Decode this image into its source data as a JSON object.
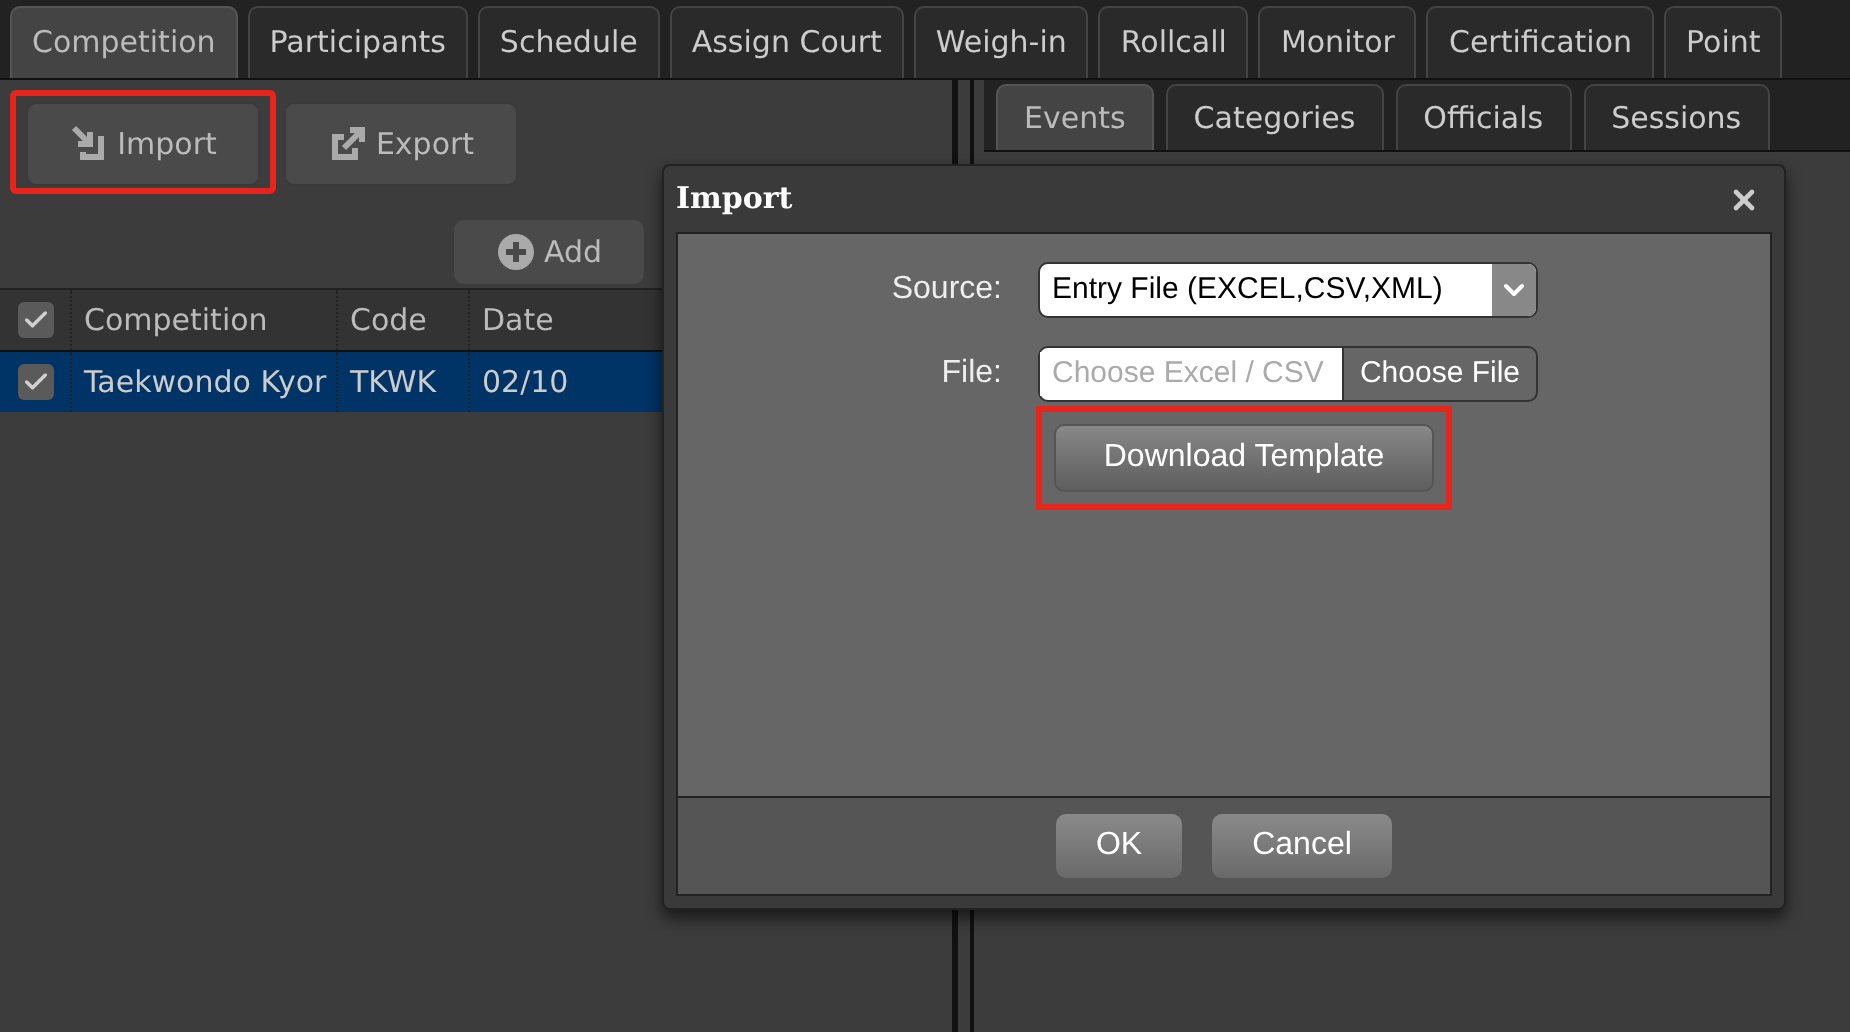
{
  "main_tabs": [
    {
      "label": "Competition",
      "selected": true
    },
    {
      "label": "Participants",
      "selected": false
    },
    {
      "label": "Schedule",
      "selected": false
    },
    {
      "label": "Assign Court",
      "selected": false
    },
    {
      "label": "Weigh-in",
      "selected": false
    },
    {
      "label": "Rollcall",
      "selected": false
    },
    {
      "label": "Monitor",
      "selected": false
    },
    {
      "label": "Certification",
      "selected": false
    },
    {
      "label": "Point",
      "selected": false
    }
  ],
  "toolbar": [
    {
      "kind": "import",
      "label": "Import",
      "highlighted": true
    },
    {
      "kind": "export",
      "label": "Export",
      "highlighted": false
    }
  ],
  "add_button": {
    "label": "Add"
  },
  "table": {
    "header_checked": true,
    "columns": [
      "Competition",
      "Code",
      "Date"
    ],
    "rows": [
      {
        "checked": true,
        "selected": true,
        "cells": [
          "Taekwondo Kyor",
          "TKWK",
          "02/10"
        ]
      }
    ]
  },
  "sub_tabs": [
    {
      "label": "Events",
      "selected": true
    },
    {
      "label": "Categories",
      "selected": false
    },
    {
      "label": "Officials",
      "selected": false
    },
    {
      "label": "Sessions",
      "selected": false
    }
  ],
  "dialog": {
    "title": "Import",
    "source": {
      "label": "Source:",
      "value": "Entry File (EXCEL,CSV,XML)"
    },
    "file": {
      "label": "File:",
      "placeholder": "Choose Excel / CSV",
      "button": "Choose File"
    },
    "template_button": {
      "label": "Download Template",
      "highlighted": true
    },
    "buttons": [
      "OK",
      "Cancel"
    ]
  }
}
